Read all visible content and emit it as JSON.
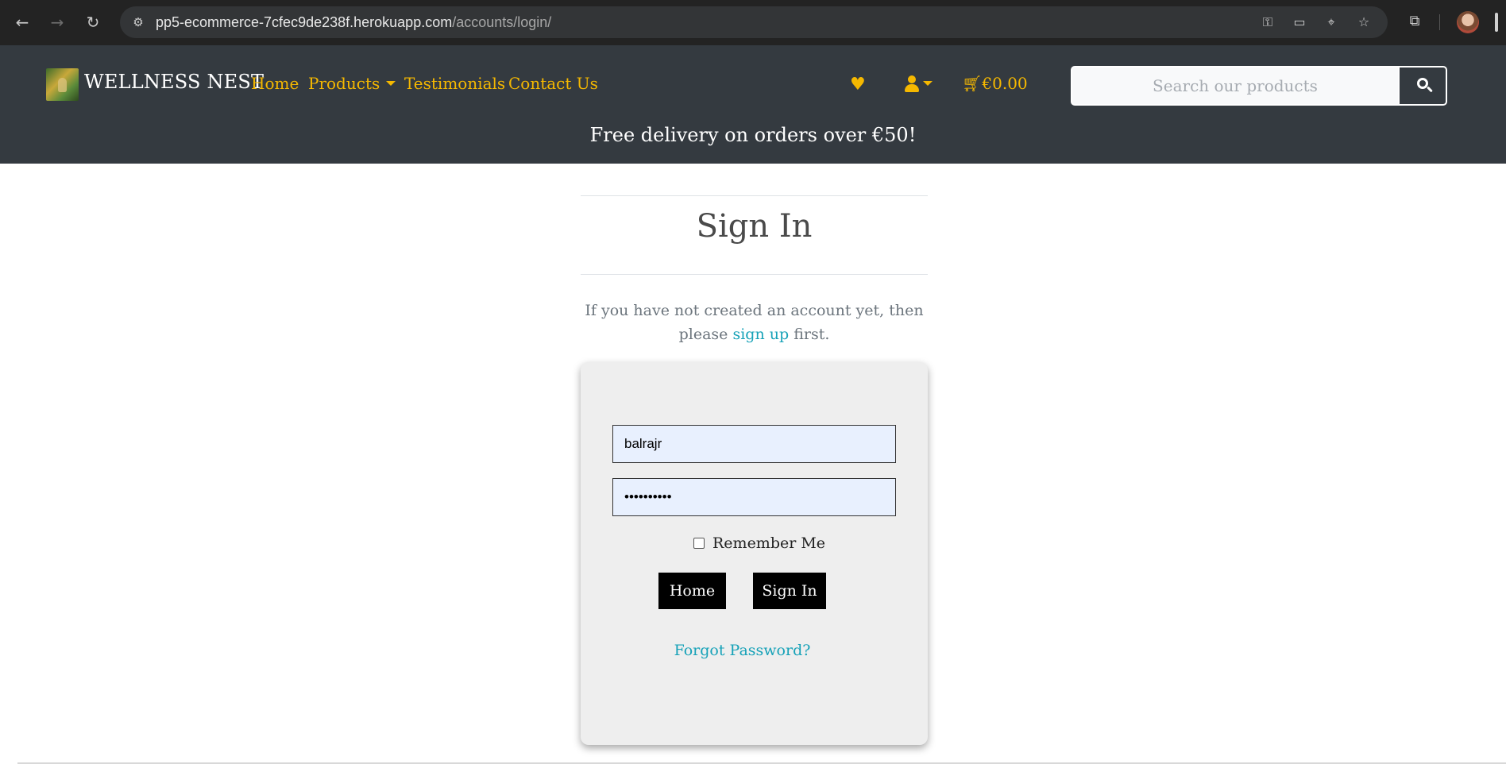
{
  "browser": {
    "url_host": "pp5-ecommerce-7cfec9de238f.herokuapp.com",
    "url_path": "/accounts/login/"
  },
  "header": {
    "brand": "WELLNESS NEST",
    "nav": {
      "home": "Home",
      "products": "Products",
      "testimonials": "Testimonials",
      "contact": "Contact Us"
    },
    "cart_total": "€0.00",
    "search_placeholder": "Search our products",
    "delivery_banner": "Free delivery on orders over €50!"
  },
  "colors": {
    "header_bg": "#343a40",
    "accent": "#f5b800",
    "link": "#17a2b8",
    "card_bg": "#eeeeee"
  },
  "main": {
    "title": "Sign In",
    "intro_before": "If you have not created an account yet, then please",
    "intro_link": "sign up",
    "intro_after": "first.",
    "form": {
      "username_value": "balrajr",
      "password_value": "••••••••••",
      "remember_label": "Remember Me",
      "remember_checked": false,
      "home_button": "Home",
      "signin_button": "Sign In",
      "forgot_link": "Forgot Password?"
    }
  }
}
